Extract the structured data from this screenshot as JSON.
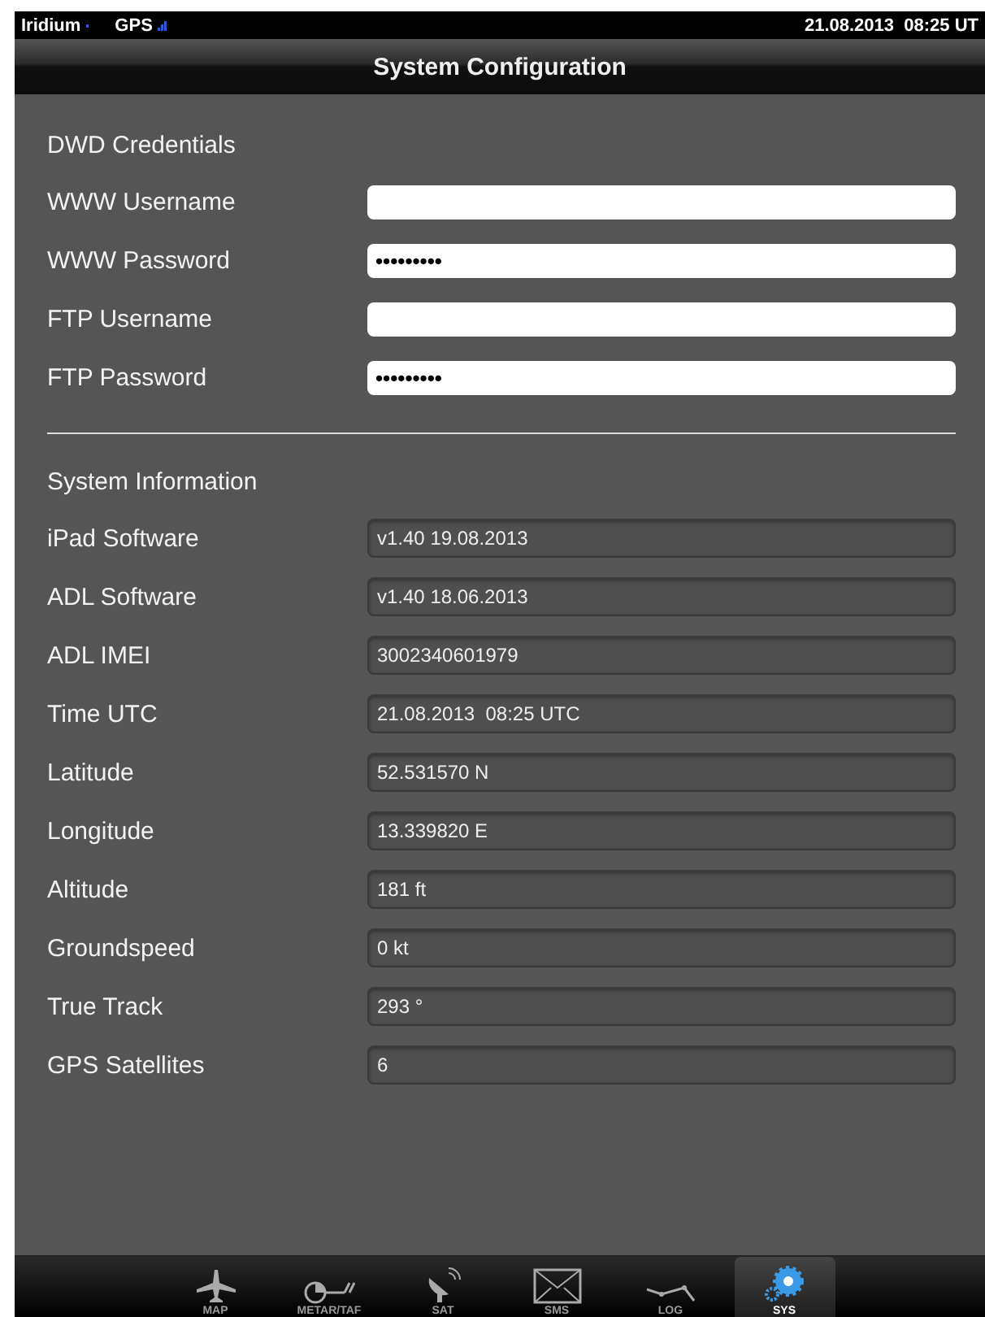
{
  "status_bar": {
    "iridium": "Iridium",
    "gps": "GPS",
    "datetime": "21.08.2013  08:25 UT"
  },
  "title": "System Configuration",
  "credentials": {
    "heading": "DWD Credentials",
    "fields": [
      {
        "label": "WWW Username"
      },
      {
        "label": "WWW Password",
        "value": "•••••••••"
      },
      {
        "label": "FTP Username"
      },
      {
        "label": "FTP Password",
        "value": "•••••••••"
      }
    ]
  },
  "system_information": {
    "heading": "System Information",
    "fields": [
      {
        "label": "iPad Software",
        "value": "v1.40 19.08.2013"
      },
      {
        "label": "ADL Software",
        "value": "v1.40 18.06.2013"
      },
      {
        "label": "ADL IMEI",
        "value": "3002340601979"
      },
      {
        "label": "Time UTC",
        "value": "21.08.2013  08:25 UTC"
      },
      {
        "label": "Latitude",
        "value": "52.531570 N"
      },
      {
        "label": "Longitude",
        "value": "13.339820 E"
      },
      {
        "label": "Altitude",
        "value": "181 ft"
      },
      {
        "label": "Groundspeed",
        "value": "0 kt"
      },
      {
        "label": "True Track",
        "value": "293 °"
      },
      {
        "label": "GPS Satellites",
        "value": "6"
      }
    ]
  },
  "tabs": [
    {
      "kind": "map",
      "label": "MAP",
      "selected": false
    },
    {
      "kind": "metar",
      "label": "METAR/TAF",
      "selected": false
    },
    {
      "kind": "sat",
      "label": "SAT",
      "selected": false
    },
    {
      "kind": "sms",
      "label": "SMS",
      "selected": false
    },
    {
      "kind": "log",
      "label": "LOG",
      "selected": false
    },
    {
      "kind": "sys",
      "label": "SYS",
      "selected": true
    }
  ]
}
